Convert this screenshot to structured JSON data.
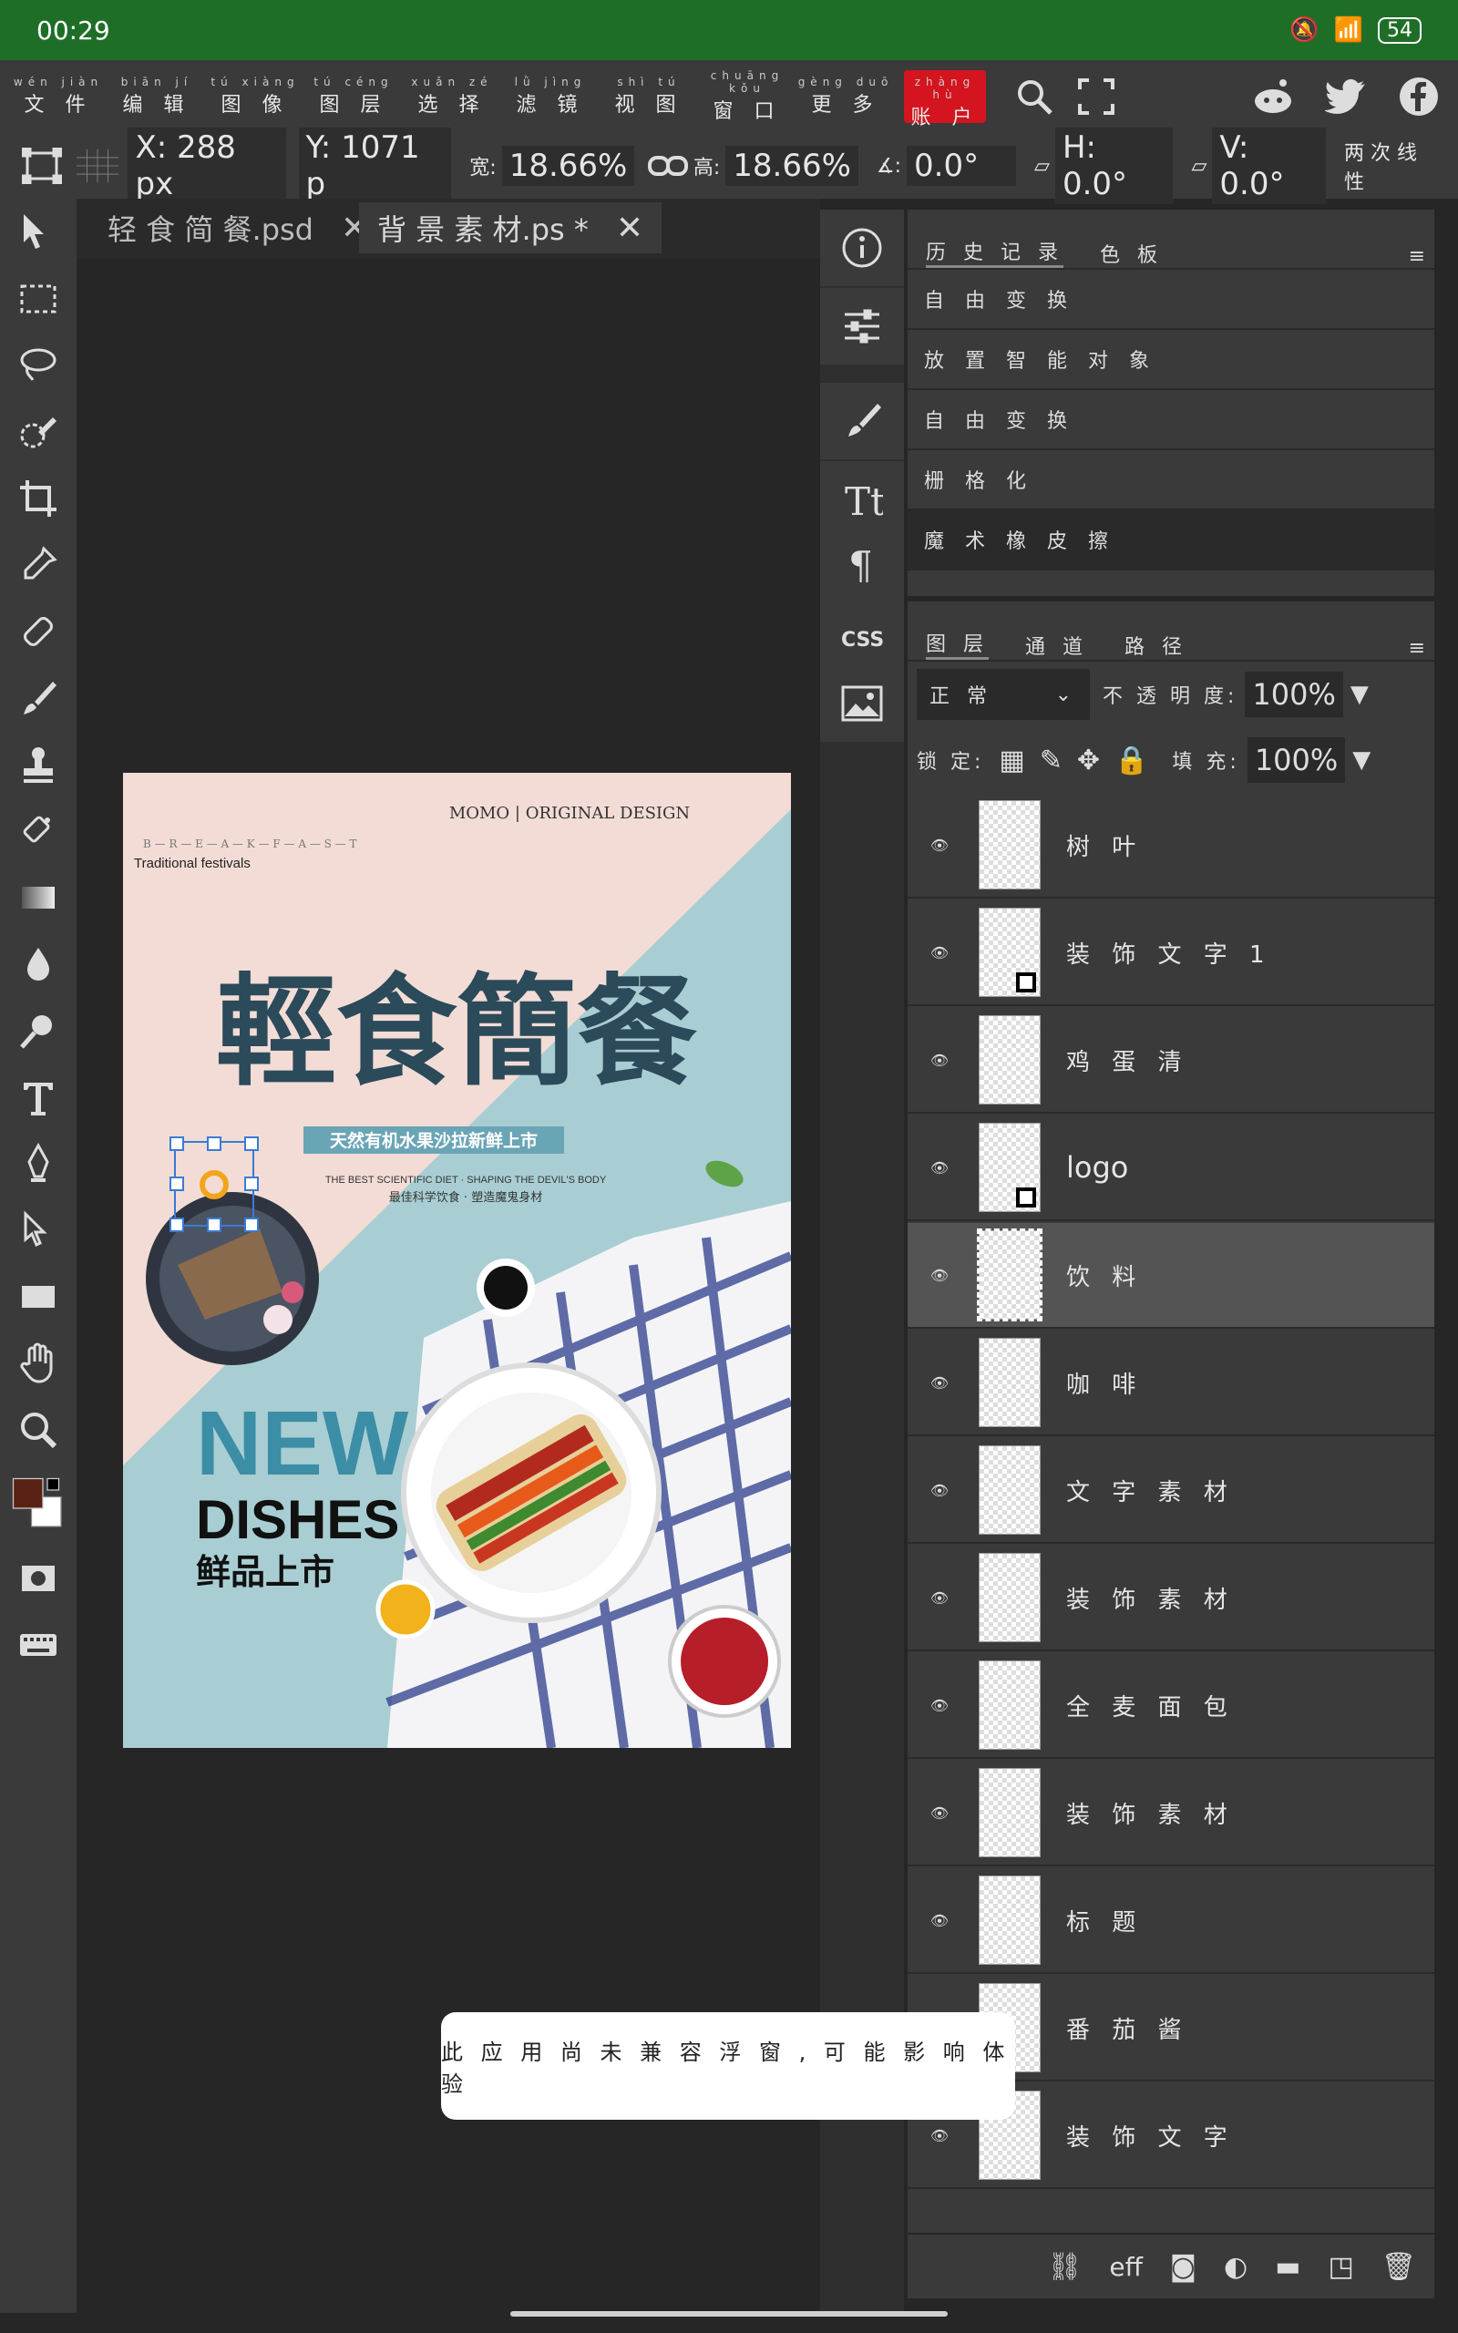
{
  "status": {
    "time": "00:29",
    "battery": "54"
  },
  "menu": {
    "file": "文 件",
    "file_py": "wén jiàn",
    "edit": "编 辑",
    "edit_py": "biān jí",
    "image": "图 像",
    "image_py": "tú xiàng",
    "layer": "图 层",
    "layer_py": "tú céng",
    "select": "选 择",
    "select_py": "xuǎn zé",
    "filter": "滤 镜",
    "filter_py": "lǜ jìng",
    "view": "视 图",
    "view_py": "shì tú",
    "window": "窗 口",
    "window_py": "chuāng kǒu",
    "more": "更 多",
    "more_py": "gèng duō",
    "account": "账 户",
    "account_py": "zhàng hù"
  },
  "options": {
    "x": "X: 288 px",
    "y": "Y: 1071 p",
    "w_label": "宽:",
    "w_value": "18.66%",
    "h_label": "高:",
    "h_value": "18.66%",
    "angle": "0.0°",
    "hskew": "H: 0.0°",
    "vskew": "V: 0.0°",
    "bicubic": "两 次 线 性"
  },
  "tabs": [
    {
      "name": "轻 食 简 餐.psd"
    },
    {
      "name": "背 景 素 材.ps *"
    }
  ],
  "history": {
    "tab_history": "历 史 记 录",
    "tab_swatches": "色 板",
    "items": [
      "自 由 变 换",
      "放 置 智 能 对 象",
      "自 由 变 换",
      "栅 格 化",
      "魔 术 橡 皮 擦"
    ]
  },
  "layers": {
    "tab_layers": "图 层",
    "tab_channels": "通 道",
    "tab_paths": "路 径",
    "blend_mode": "正 常",
    "opacity_label": "不 透 明 度:",
    "opacity": "100%",
    "lock_label": "锁 定:",
    "fill_label": "填 充:",
    "fill": "100%",
    "items": [
      "树 叶",
      "装 饰 文 字 1",
      "鸡 蛋 清",
      "logo",
      "饮 料",
      "咖 啡",
      "文 字 素 材",
      "装 饰 素 材",
      "全 麦 面 包",
      "装 饰 素 材",
      "标 题",
      "番 茄 酱",
      "装 饰 文 字"
    ]
  },
  "toast": "此 应 用 尚 未 兼 容 浮 窗 , 可 能 影 响 体 验",
  "poster": {
    "brand": "MOMO | ORIGINAL DESIGN",
    "breakfast": "B — R — E — A — K — F — A — S — T",
    "tagline_en": "Traditional festivals",
    "title": "輕食簡餐",
    "banner": "天然有机水果沙拉新鲜上市",
    "sub_en": "THE BEST SCIENTIFIC DIET · SHAPING THE DEVIL'S BODY",
    "sub_cn": "最佳科学饮食 · 塑造魔鬼身材",
    "new": "NEW",
    "dishes": "DISHES",
    "fresh": "鲜品上市"
  },
  "colors": {
    "status": "#1f6e28",
    "account": "#d4141e",
    "poster_pink": "#f3dcd6",
    "poster_blue": "#a8ced3",
    "title": "#2b4a5a"
  }
}
